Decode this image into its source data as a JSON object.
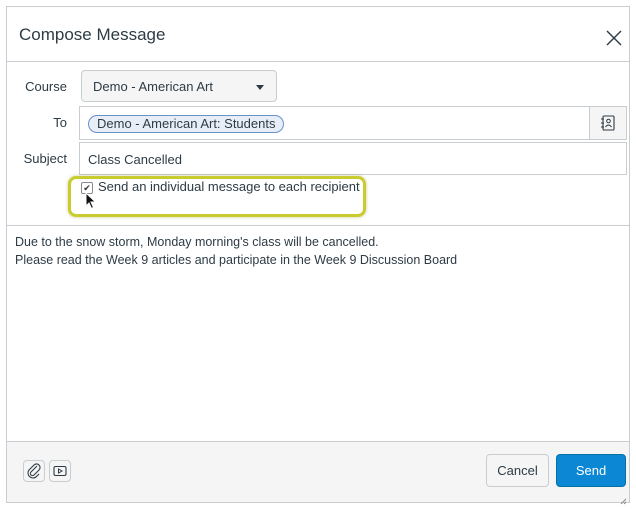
{
  "dialog": {
    "title": "Compose Message",
    "close_icon": "close-icon"
  },
  "form": {
    "course_label": "Course",
    "course_value": "Demo - American Art",
    "to_label": "To",
    "to_recipients": [
      "Demo - American Art: Students"
    ],
    "subject_label": "Subject",
    "subject_value": "Class Cancelled",
    "individual_message_label": "Send an individual message to each recipient",
    "individual_message_checked": true
  },
  "message": {
    "lines": [
      "Due to the snow storm, Monday morning's class will be cancelled.",
      "Please read the Week 9 articles and participate in the Week 9 Discussion Board"
    ]
  },
  "footer": {
    "attach_icon": "paperclip-icon",
    "media_icon": "media-icon",
    "cancel_label": "Cancel",
    "send_label": "Send"
  },
  "colors": {
    "accent": "#0b87d4",
    "highlight": "#c9cc2e"
  }
}
